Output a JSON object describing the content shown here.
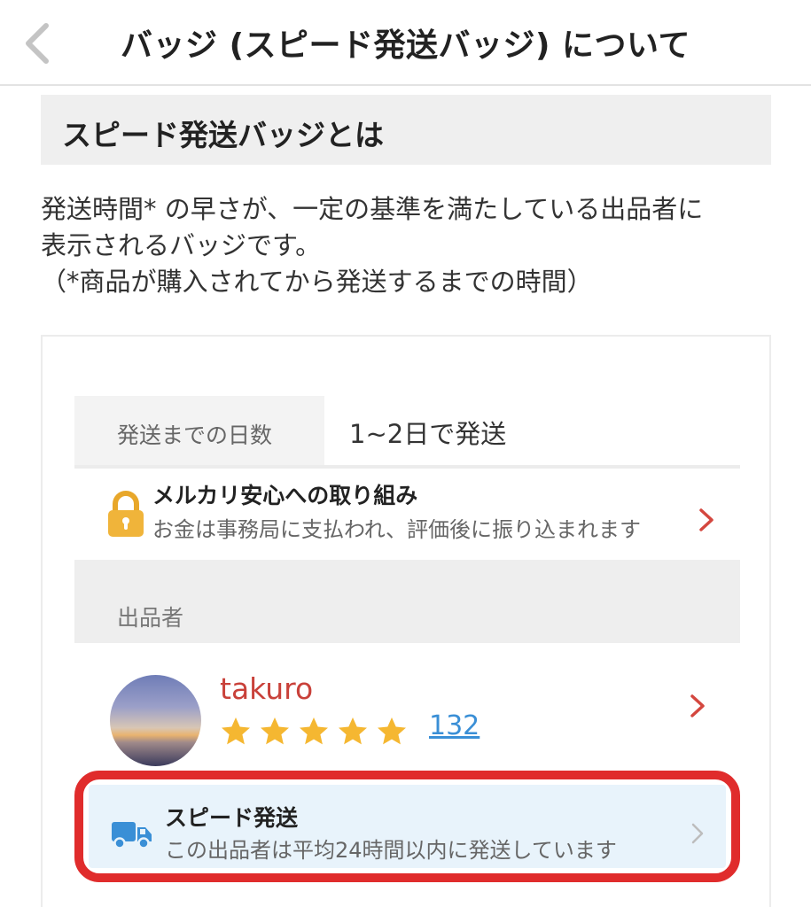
{
  "header": {
    "title": "バッジ (スピード発送バッジ) について",
    "back_icon": "chevron-left-icon"
  },
  "section": {
    "heading": "スピード発送バッジとは"
  },
  "description": {
    "line1": "発送時間* の早さが、一定の基準を満たしている出品者に",
    "line2": "表示されるバッジです。",
    "line3": "（*商品が購入されてから発送するまでの時間）"
  },
  "example": {
    "shipping": {
      "label": "発送までの日数",
      "value": "1~2日で発送"
    },
    "safety": {
      "icon": "lock-icon",
      "title": "メルカリ安心への取り組み",
      "subtitle": "お金は事務局に支払われ、評価後に振り込まれます"
    },
    "seller_section": {
      "label": "出品者"
    },
    "seller": {
      "name": "takuro",
      "rating_stars": 5,
      "review_count": "132"
    },
    "speed_badge": {
      "icon": "truck-icon",
      "title": "スピード発送",
      "subtitle": "この出品者は平均24時間以内に発送しています"
    }
  },
  "colors": {
    "accent_red": "#e02c2c",
    "seller_name": "#c9413a",
    "link_blue": "#3a8fd6",
    "star_gold": "#f5b731",
    "badge_bg": "#e8f3fb",
    "truck_blue": "#3a8fd6"
  }
}
